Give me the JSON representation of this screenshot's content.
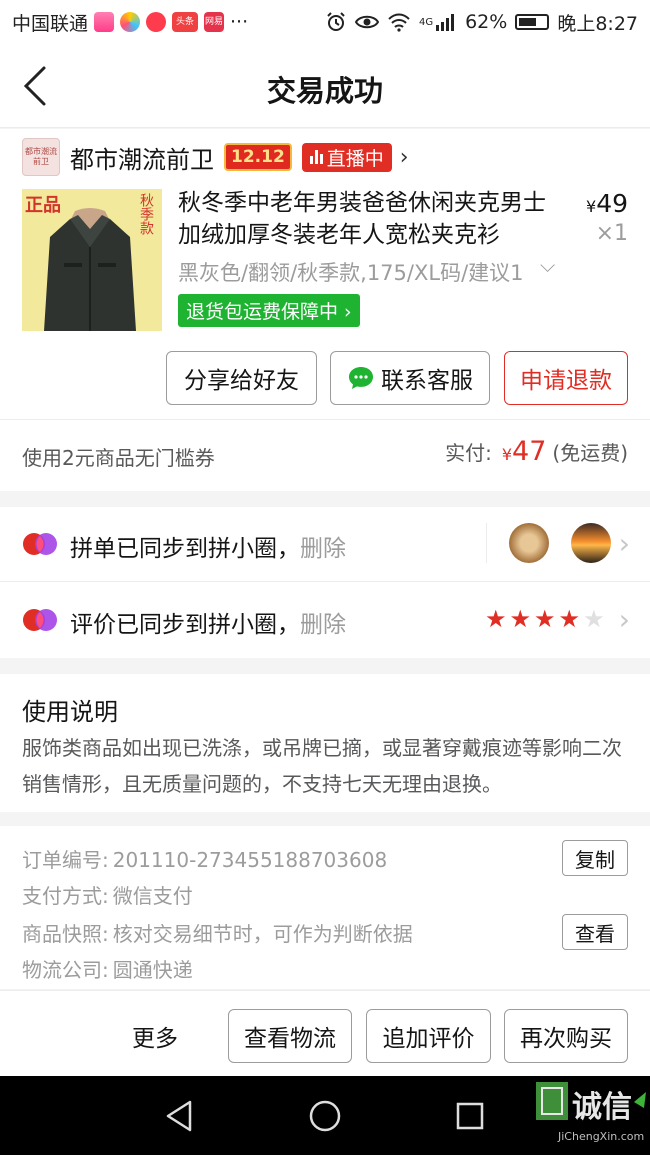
{
  "status_bar": {
    "carrier": "中国联通",
    "app_icons": [
      "app-icon-pink",
      "app-icon-colorful",
      "app-icon-red-play",
      "app-icon-toutiao",
      "app-icon-wangyi"
    ],
    "toutiao_label": "头条",
    "wangyi_label": "网易",
    "more": "···",
    "network": "4G",
    "battery": "62%",
    "time": "晚上8:27"
  },
  "nav": {
    "title": "交易成功"
  },
  "shop": {
    "logo_text": "都市潮流前卫",
    "name": "都市潮流前卫",
    "promo_badge": "12.12",
    "live_badge": "直播中"
  },
  "product": {
    "image_tag_1": "正品",
    "image_tag_2": "秋季款",
    "title": "秋冬季中老年男装爸爸休闲夹克男士加绒加厚冬装老年人宽松夹克衫",
    "currency": "¥",
    "price": "49",
    "quantity": "×1",
    "spec": "黑灰色/翻领/秋季款,175/XL码/建议1",
    "guarantee": "退货包运费保障中"
  },
  "actions": {
    "share": "分享给好友",
    "service": "联系客服",
    "refund": "申请退款"
  },
  "payment": {
    "coupon": "使用2元商品无门槛券",
    "paid_label": "实付:",
    "currency": "¥",
    "amount": "47",
    "shipping": "(免运费)"
  },
  "sync": {
    "order_text": "拼单已同步到拼小圈，",
    "review_text": "评价已同步到拼小圈，",
    "delete": "删除",
    "rating": 4,
    "rating_max": 5
  },
  "instructions": {
    "title": "使用说明",
    "body": "服饰类商品如出现已洗涤，或吊牌已摘，或显著穿戴痕迹等影响二次销售情形，且无质量问题的，不支持七天无理由退换。"
  },
  "order_info": {
    "order_no_label": "订单编号:",
    "order_no": "201110-273455188703608",
    "copy": "复制",
    "pay_method_label": "支付方式:",
    "pay_method": "微信支付",
    "snapshot_label": "商品快照:",
    "snapshot": "核对交易细节时，可作为判断依据",
    "view": "查看",
    "logistics_label": "物流公司:",
    "logistics": "圆通快递"
  },
  "bottom_bar": {
    "more": "更多",
    "track": "查看物流",
    "add_review": "追加评价",
    "buy_again": "再次购买"
  },
  "watermark": {
    "text": "诚信",
    "sub": "JiChengXin.com"
  },
  "colors": {
    "accent": "#e02e24",
    "green": "#1fb332",
    "gray_text": "#9c9c9c"
  }
}
